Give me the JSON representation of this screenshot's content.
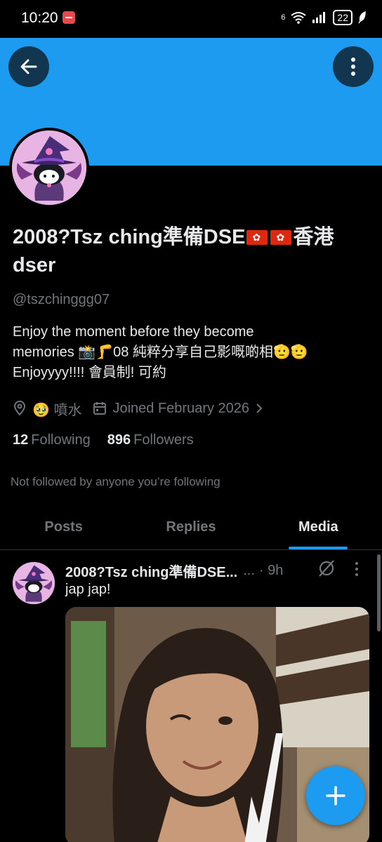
{
  "status_bar": {
    "time": "10:20",
    "signal": "6",
    "battery": "22"
  },
  "profile": {
    "name_part1": "2008?Tsz ching準備DSE",
    "name_part2": "香港dser",
    "handle": "@tszchinggg07",
    "bio_line1": "Enjoy the moment before they become",
    "bio_line2_a": "memories 📸🦵08 純粹分享自己影嘅啲相",
    "bio_line2_emoji": "🫡🫡",
    "bio_line3": "Enjoyyyy!!!! 會員制! 可約",
    "location": "🥹 噴水",
    "joined": "Joined February 2026",
    "following_count": "12",
    "following_label": "Following",
    "followers_count": "896",
    "followers_label": "Followers",
    "not_followed": "Not followed by anyone you’re following"
  },
  "tabs": [
    {
      "label": "Posts"
    },
    {
      "label": "Replies"
    },
    {
      "label": "Media"
    }
  ],
  "active_tab": "Media",
  "post": {
    "author": "2008?Tsz ching準備DSE...",
    "dots": "...",
    "time": "· 9h",
    "text": "jap jap!"
  },
  "colors": {
    "accent": "#1d9bf0",
    "background": "#000000",
    "muted": "#71767b",
    "text": "#e7e9ea"
  },
  "icons": [
    "back-arrow-icon",
    "more-vertical-icon",
    "location-icon",
    "calendar-icon",
    "chevron-right-icon",
    "grok-icon",
    "plus-icon"
  ]
}
